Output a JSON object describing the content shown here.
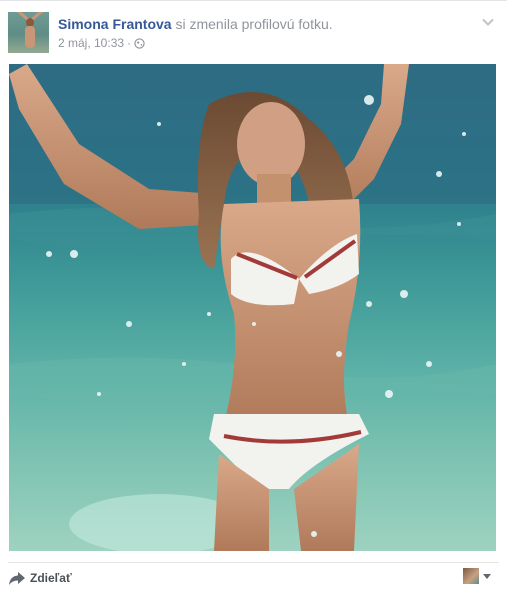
{
  "post": {
    "author": "Simona Frantova",
    "action": " si zmenila profilovú fotku.",
    "timestamp": "2 máj, 10:33",
    "separator": "·",
    "privacy_icon": "globe-icon",
    "options_icon": "chevron-down-icon"
  },
  "photo": {
    "subject": "profile-photo"
  },
  "footer": {
    "share_label": "Zdieľať",
    "share_icon": "share-arrow-icon",
    "audience_icon": "avatar-selector",
    "dropdown_icon": "caret-down-icon"
  },
  "colors": {
    "link": "#365899",
    "meta": "#90949c",
    "footer_text": "#4b4f56"
  }
}
